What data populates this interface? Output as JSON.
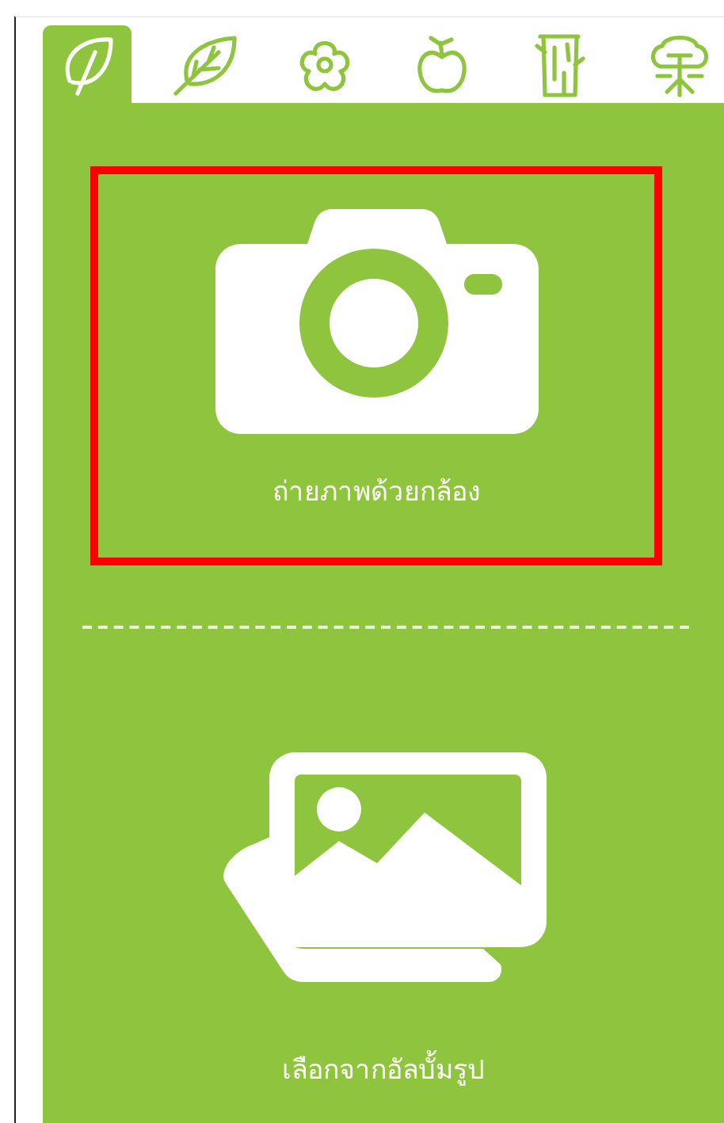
{
  "tabs": [
    {
      "kind": "leaf-outline",
      "selected": true
    },
    {
      "kind": "leaf",
      "selected": false
    },
    {
      "kind": "flower",
      "selected": false
    },
    {
      "kind": "apple",
      "selected": false
    },
    {
      "kind": "trunk",
      "selected": false
    },
    {
      "kind": "tree",
      "selected": false
    }
  ],
  "options": [
    {
      "kind": "camera",
      "label": "ถ่ายภาพด้วยกล้อง",
      "highlighted": true
    },
    {
      "kind": "gallery",
      "label": "เลือกจากอัลบั้มรูป",
      "highlighted": false
    }
  ]
}
